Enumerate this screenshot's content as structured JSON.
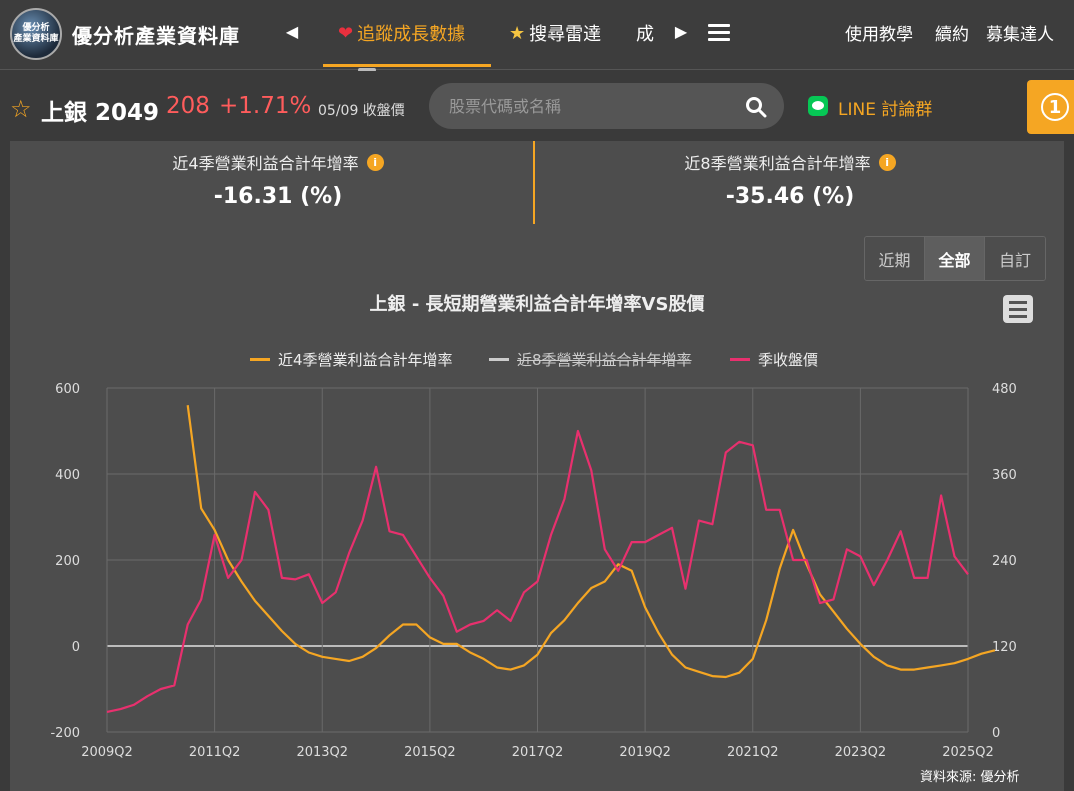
{
  "nav": {
    "logo_line1": "優分析",
    "logo_line2": "產業資料庫",
    "site_title": "優分析產業資料庫",
    "tabs": [
      {
        "label": "追蹤成長數據",
        "icon": "heart-icon"
      },
      {
        "label": "搜尋雷達",
        "icon": "star-icon"
      },
      {
        "label": "成",
        "icon": ""
      }
    ],
    "right_links": [
      "使用教學",
      "續約",
      "募集達人"
    ]
  },
  "stock": {
    "name": "上銀 2049",
    "price": "208",
    "change": "+1.71%",
    "date": "05/09 收盤價",
    "search_placeholder": "股票代碼或名稱",
    "line_label": "LINE 討論群",
    "badge": "1"
  },
  "metrics": [
    {
      "label": "近4季營業利益合計年增率",
      "value": "-16.31 (%)"
    },
    {
      "label": "近8季營業利益合計年增率",
      "value": "-35.46 (%)"
    }
  ],
  "range_buttons": [
    "近期",
    "全部",
    "自訂"
  ],
  "range_active": "全部",
  "source": "資料來源: 優分析",
  "colors": {
    "accent": "#f5a623",
    "price_up": "#ff5c5c",
    "series_price": "#e8306e"
  },
  "chart_data": {
    "type": "line",
    "title": "上銀 - 長短期營業利益合計年增率VS股價",
    "legend_position": "top-center",
    "grid": true,
    "x_ticks": [
      "2009Q2",
      "2011Q2",
      "2013Q2",
      "2015Q2",
      "2017Q2",
      "2019Q2",
      "2021Q2",
      "2023Q2",
      "2025Q2"
    ],
    "x_start": "2009Q2",
    "x_end": "2025Q2",
    "y_left": {
      "range": [
        -200,
        600
      ],
      "ticks": [
        -200,
        0,
        200,
        400,
        600
      ]
    },
    "y_right": {
      "range": [
        0,
        480
      ],
      "ticks": [
        0,
        120,
        240,
        360,
        480
      ]
    },
    "series": [
      {
        "name": "近4季營業利益合計年增率",
        "axis": "left",
        "color": "#f5a623",
        "visible": true,
        "start": "2010Q4",
        "values": [
          560,
          320,
          270,
          200,
          150,
          105,
          70,
          35,
          5,
          -15,
          -25,
          -30,
          -35,
          -25,
          -5,
          25,
          50,
          50,
          20,
          5,
          5,
          -15,
          -30,
          -50,
          -55,
          -45,
          -20,
          30,
          60,
          100,
          135,
          150,
          190,
          175,
          90,
          30,
          -20,
          -50,
          -60,
          -70,
          -72,
          -62,
          -30,
          60,
          180,
          270,
          190,
          120,
          80,
          40,
          5,
          -25,
          -45,
          -55,
          -55,
          -50,
          -45,
          -40,
          -30,
          -18,
          -10
        ]
      },
      {
        "name": "近8季營業利益合計年增率",
        "axis": "left",
        "color": "#cccccc",
        "visible": false,
        "start": "2010Q4",
        "values": []
      },
      {
        "name": "季收盤價",
        "axis": "right",
        "color": "#e8306e",
        "visible": true,
        "start": "2009Q2",
        "values": [
          28,
          32,
          38,
          50,
          60,
          65,
          150,
          185,
          275,
          215,
          240,
          335,
          310,
          215,
          213,
          220,
          180,
          195,
          250,
          295,
          370,
          280,
          275,
          245,
          215,
          190,
          140,
          150,
          155,
          170,
          155,
          195,
          210,
          275,
          325,
          420,
          365,
          255,
          225,
          265,
          265,
          275,
          285,
          200,
          295,
          290,
          390,
          405,
          400,
          310,
          310,
          240,
          240,
          180,
          185,
          255,
          245,
          205,
          240,
          280,
          215,
          215,
          330,
          245,
          220
        ]
      }
    ]
  }
}
